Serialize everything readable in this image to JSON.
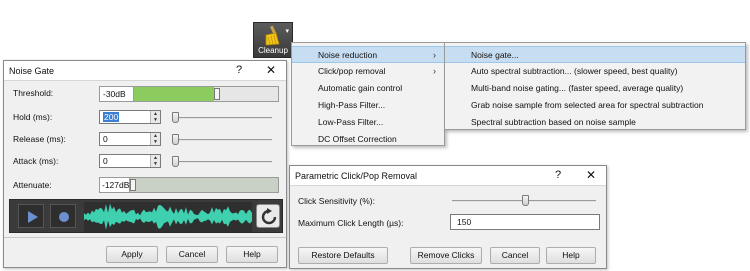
{
  "cleanup": {
    "label": "Cleanup"
  },
  "menu": {
    "items": [
      {
        "label": "Noise reduction",
        "submenu": true,
        "selected": true
      },
      {
        "label": "Click/pop removal",
        "submenu": true
      },
      {
        "label": "Automatic gain control"
      },
      {
        "label": "High-Pass Filter..."
      },
      {
        "label": "Low-Pass Filter..."
      },
      {
        "label": "DC Offset Correction"
      }
    ]
  },
  "submenu": {
    "items": [
      {
        "label": "Noise gate...",
        "selected": true
      },
      {
        "label": "Auto spectral subtraction... (slower speed, best quality)"
      },
      {
        "label": "Multi-band noise gating... (faster speed, average quality)"
      },
      {
        "label": "Grab noise sample from selected area for spectral subtraction"
      },
      {
        "label": "Spectral subtraction based on noise sample"
      }
    ]
  },
  "noise_gate": {
    "title": "Noise Gate",
    "help_glyph": "?",
    "close_glyph": "✕",
    "threshold": {
      "label": "Threshold:",
      "value": "-30dB",
      "level": 0.64
    },
    "hold": {
      "label": "Hold (ms):",
      "value": "200"
    },
    "release": {
      "label": "Release (ms):",
      "value": "0"
    },
    "attack": {
      "label": "Attack (ms):",
      "value": "0"
    },
    "attenuate": {
      "label": "Attenuate:",
      "value": "-127dB",
      "level": 0.0
    },
    "buttons": {
      "apply": "Apply",
      "cancel": "Cancel",
      "help": "Help"
    },
    "colors": {
      "level_green": "#8ccc5e",
      "waveform": "#3fd0b0",
      "player_bg": "#3b3b3b"
    }
  },
  "click_pop": {
    "title": "Parametric Click/Pop Removal",
    "help_glyph": "?",
    "close_glyph": "✕",
    "sensitivity": {
      "label": "Click Sensitivity (%):"
    },
    "max_length": {
      "label": "Maximum Click Length (µs):",
      "value": "150"
    },
    "buttons": {
      "restore": "Restore Defaults",
      "remove": "Remove Clicks",
      "cancel": "Cancel",
      "help": "Help"
    }
  }
}
